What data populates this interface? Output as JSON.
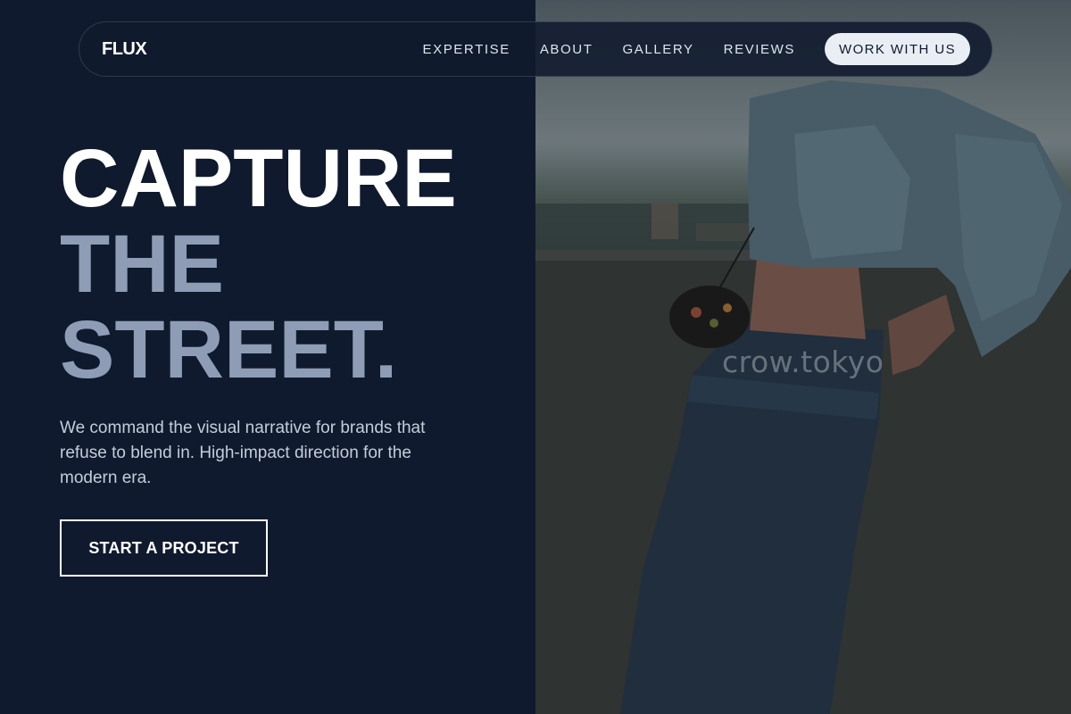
{
  "brand": {
    "logo": "FLUX"
  },
  "nav": {
    "links": [
      "EXPERTISE",
      "ABOUT",
      "GALLERY",
      "REVIEWS"
    ],
    "cta_label": "WORK WITH US"
  },
  "hero": {
    "headline_line1": "CAPTURE",
    "headline_line2": "THE",
    "headline_line3": "STREET.",
    "subtitle": "We command the visual narrative for brands that refuse to blend in. High-impact direction for the modern era.",
    "cta_label": "START A PROJECT"
  },
  "photo": {
    "watermark": "crow.tokyo"
  },
  "colors": {
    "background": "#101a2e",
    "headline_accent": "#8e9db5",
    "nav_cta_bg": "#e9eef5",
    "text_muted": "#c3cdda"
  }
}
